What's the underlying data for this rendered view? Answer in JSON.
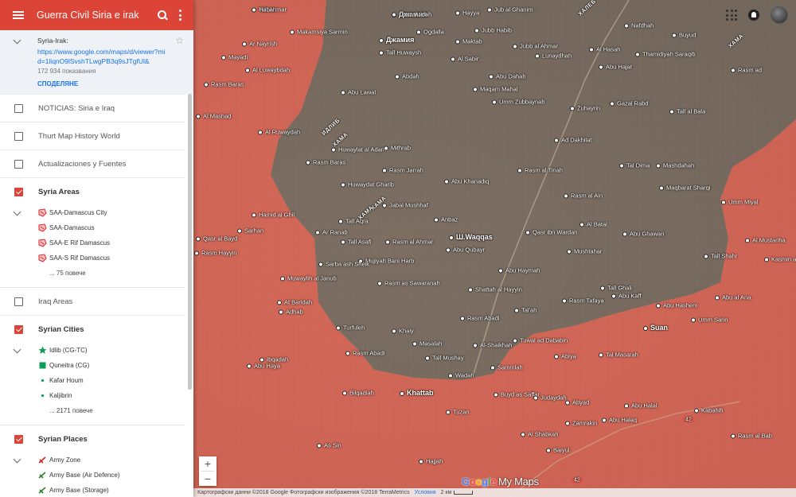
{
  "header": {
    "title": "Guerra Civil Siria e irak",
    "bg_color": "#db4437"
  },
  "map_info": {
    "name": "Syria-Irak:",
    "url": "https://www.google.com/maps/d/viewer?mid=1liqnO9lSvshTLwgPB3q9sJTgfUl&",
    "views": "172 934 показвания",
    "share_label": "СПОДЕЛЯНЕ"
  },
  "layers": [
    {
      "label": "NOTICIAS: Siria e Iraq",
      "checked": false
    },
    {
      "label": "Thurt Map History World",
      "checked": false
    },
    {
      "label": "Actualizaciones y Fuentes",
      "checked": false
    },
    {
      "label": "Syria Areas",
      "checked": true,
      "items": [
        "SAA-Damascus City",
        "SAA-Damascus",
        "SAA-E Rif Damascus",
        "SAA-S Rif Damascus"
      ],
      "more": "... 75 повече"
    },
    {
      "label": "Iraq Areas",
      "checked": false
    },
    {
      "label": "Syrian Cities",
      "checked": true,
      "items": [
        "Idlib (CG-TC)",
        "Quneitra (CG)",
        "Kafar Houm",
        "Kaljibrin"
      ],
      "more": "... 2171 повече"
    },
    {
      "label": "Syrian Places",
      "checked": true,
      "items": [
        "Army Zone",
        "Army Base (Air Defence)",
        "Army Base (Storage)"
      ]
    }
  ],
  "zoom": {
    "in": "+",
    "out": "−"
  },
  "google_logo": {
    "letters": [
      "G",
      "o",
      "o",
      "g",
      "l",
      "e"
    ],
    "suffix": "My Maps"
  },
  "footer": {
    "attribution": "Картографски данни ©2018 Google Фотографски изображения ©2018 TerraMetrics",
    "terms": "Условия",
    "scale": "2 км"
  },
  "colors": {
    "red_zone": "#d9574a",
    "gray_zone": "#6e6660",
    "terrain": "#b09c80",
    "accent": "#1a73e8"
  },
  "places": [
    {
      "name": "Tall Ahmar",
      "big": false
    },
    {
      "name": "Джамия",
      "big": true
    },
    {
      "name": "Hayya",
      "big": false
    },
    {
      "name": "Jub al Ghanim",
      "big": false
    },
    {
      "name": "Jubb Habib",
      "big": false
    },
    {
      "name": "Nafdhah",
      "big": false
    },
    {
      "name": "Buyud",
      "big": false
    },
    {
      "name": "Makamsiya Sarmin",
      "big": false
    },
    {
      "name": "Джамия",
      "big": true
    },
    {
      "name": "Ogdalla",
      "big": false
    },
    {
      "name": "Ar Nayrish",
      "big": false
    },
    {
      "name": "Tall Huwaysh",
      "big": false
    },
    {
      "name": "Maktab",
      "big": false
    },
    {
      "name": "Jubb al Ahmar",
      "big": false
    },
    {
      "name": "Al Hasah",
      "big": false
    },
    {
      "name": "Thamidiyah Saraqib",
      "big": false
    },
    {
      "name": "Mayadi",
      "big": false
    },
    {
      "name": "Al Luwaybdah",
      "big": false
    },
    {
      "name": "Al Sabir",
      "big": false
    },
    {
      "name": "Lunaydhah",
      "big": false
    },
    {
      "name": "Abu Hajat",
      "big": false
    },
    {
      "name": "Rasm Baras",
      "big": false
    },
    {
      "name": "Abdah",
      "big": false
    },
    {
      "name": "Abu Dahah",
      "big": false
    },
    {
      "name": "Maqam Mahal",
      "big": false
    },
    {
      "name": "Abu Lawal",
      "big": false
    },
    {
      "name": "Umm Zubbaynah",
      "big": false
    },
    {
      "name": "Rasm ad",
      "big": false
    },
    {
      "name": "Zuhayrin",
      "big": false
    },
    {
      "name": "Gazal Rabd",
      "big": false
    },
    {
      "name": "Al Mashad",
      "big": false
    },
    {
      "name": "Tall al Bala",
      "big": false
    },
    {
      "name": "Ad Dakhilat",
      "big": false
    },
    {
      "name": "Al Ruwaydah",
      "big": false
    },
    {
      "name": "Huwaylat al Adam",
      "big": false
    },
    {
      "name": "Mithrab",
      "big": false
    },
    {
      "name": "Rasm Jarrah",
      "big": false
    },
    {
      "name": "Rasm al Tinah",
      "big": false
    },
    {
      "name": "Tal Dima",
      "big": false
    },
    {
      "name": "Rasm Baras",
      "big": false
    },
    {
      "name": "Mashdahah",
      "big": false
    },
    {
      "name": "Huwaydat Gharib",
      "big": false
    },
    {
      "name": "Abu Khanadiq",
      "big": false
    },
    {
      "name": "Maqbarat Sharqi",
      "big": false
    },
    {
      "name": "Jabal Mushhaf",
      "big": false
    },
    {
      "name": "Rasm al Ain",
      "big": false
    },
    {
      "name": "Tall Aqra",
      "big": false
    },
    {
      "name": "Ar Ranab",
      "big": false
    },
    {
      "name": "Umm Miyal",
      "big": false
    },
    {
      "name": "Tall Asafi",
      "big": false
    },
    {
      "name": "Al Batal",
      "big": false
    },
    {
      "name": "Anbaz",
      "big": false
    },
    {
      "name": "Ш.Waqqas",
      "big": true
    },
    {
      "name": "Abu Qubayr",
      "big": false
    },
    {
      "name": "Al Mustariha",
      "big": false
    },
    {
      "name": "Qasr ibn Wardan",
      "big": false
    },
    {
      "name": "Rasm Hayyin",
      "big": false
    },
    {
      "name": "Rasm al Ahmar",
      "big": false
    },
    {
      "name": "Abu Ghawan",
      "big": false
    },
    {
      "name": "Mushtahar",
      "big": false
    },
    {
      "name": "Hamid al Ghil",
      "big": false
    },
    {
      "name": "Sarhan",
      "big": false
    },
    {
      "name": "Qasr al Bayd",
      "big": false
    },
    {
      "name": "Abu Haymah",
      "big": false
    },
    {
      "name": "Mujiyah Bani Harb",
      "big": false
    },
    {
      "name": "Tall Shahr",
      "big": false
    },
    {
      "name": "Kasmin ash Shaikh",
      "big": false
    },
    {
      "name": "Sarba ash Sheik",
      "big": false
    },
    {
      "name": "Muwaylih al Janub",
      "big": false
    },
    {
      "name": "Rasm as Sawaranah",
      "big": false
    },
    {
      "name": "Tall Ghali",
      "big": false
    },
    {
      "name": "Shattah al Hayyin",
      "big": false
    },
    {
      "name": "Rasm Tafaya",
      "big": false
    },
    {
      "name": "Abu Kaff",
      "big": false
    },
    {
      "name": "Abu al Ana",
      "big": false
    },
    {
      "name": "At Baridah",
      "big": false
    },
    {
      "name": "Adhab",
      "big": false
    },
    {
      "name": "Tal'ah",
      "big": false
    },
    {
      "name": "Abu Hashem",
      "big": false
    },
    {
      "name": "Turfuleh",
      "big": false
    },
    {
      "name": "Rasm Abadi",
      "big": false
    },
    {
      "name": "Suan",
      "big": true
    },
    {
      "name": "Umm Sarin",
      "big": false
    },
    {
      "name": "Khaiy",
      "big": false
    },
    {
      "name": "Tuwal ad Dababin",
      "big": false
    },
    {
      "name": "Masalah",
      "big": false
    },
    {
      "name": "Rasm Abadi",
      "big": false
    },
    {
      "name": "Al-Shaikhah",
      "big": false
    },
    {
      "name": "Abiya",
      "big": false
    },
    {
      "name": "Tal Masarah",
      "big": false
    },
    {
      "name": "Tall Mushay",
      "big": false
    },
    {
      "name": "Wadah",
      "big": false
    },
    {
      "name": "Sammlah",
      "big": false
    },
    {
      "name": "Abu Haya",
      "big": false
    },
    {
      "name": "Ibqadah",
      "big": false
    },
    {
      "name": "Bilqadiah",
      "big": false
    },
    {
      "name": "Khattab",
      "big": true
    },
    {
      "name": "Buyd as Saffar",
      "big": false
    },
    {
      "name": "Judaydah",
      "big": false
    },
    {
      "name": "Abyad",
      "big": false
    },
    {
      "name": "Abu Halal",
      "big": false
    },
    {
      "name": "Abu Halaq",
      "big": false
    },
    {
      "name": "Tuzan",
      "big": false
    },
    {
      "name": "Kabahih",
      "big": false
    },
    {
      "name": "Zamrakin",
      "big": false
    },
    {
      "name": "Al Shabkah",
      "big": false
    },
    {
      "name": "As Sin",
      "big": false
    },
    {
      "name": "Hajjah",
      "big": false
    },
    {
      "name": "Baiyul",
      "big": false
    },
    {
      "name": "Rasm al Bab",
      "big": false
    },
    {
      "name": "Habari",
      "big": false
    },
    {
      "name": "Umm Aridah",
      "big": false
    }
  ],
  "region_labels": [
    "ИДЛИБ",
    "ХАМА",
    "ХАМА",
    "ХАМА",
    "ХАЛЕБ",
    "ХАМА"
  ],
  "roads": [
    "42",
    "42"
  ]
}
